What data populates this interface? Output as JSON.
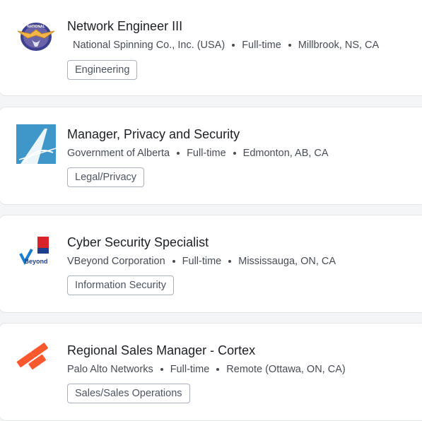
{
  "jobs": [
    {
      "title": "Network Engineer III",
      "company": "National Spinning Co., Inc. (USA)",
      "type": "Full-time",
      "location": "Millbrook, NS, CA",
      "tag": "Engineering",
      "logo": "national-spinning-eagle-logo",
      "logo_text": "NATIONAL"
    },
    {
      "title": "Manager, Privacy and Security",
      "company": "Government of Alberta",
      "type": "Full-time",
      "location": "Edmonton, AB, CA",
      "tag": "Legal/Privacy",
      "logo": "government-of-alberta-logo",
      "logo_color": "#3f97c9"
    },
    {
      "title": "Cyber Security Specialist",
      "company": "VBeyond Corporation",
      "type": "Full-time",
      "location": "Mississauga, ON, CA",
      "tag": "Information Security",
      "logo": "vbeyond-logo",
      "logo_text": "Beyond"
    },
    {
      "title": "Regional Sales Manager - Cortex",
      "company": "Palo Alto Networks",
      "type": "Full-time",
      "location": "Remote (Ottawa, ON, CA)",
      "tag": "Sales/Sales Operations",
      "logo": "palo-alto-networks-logo",
      "logo_color": "#fa582d"
    }
  ]
}
